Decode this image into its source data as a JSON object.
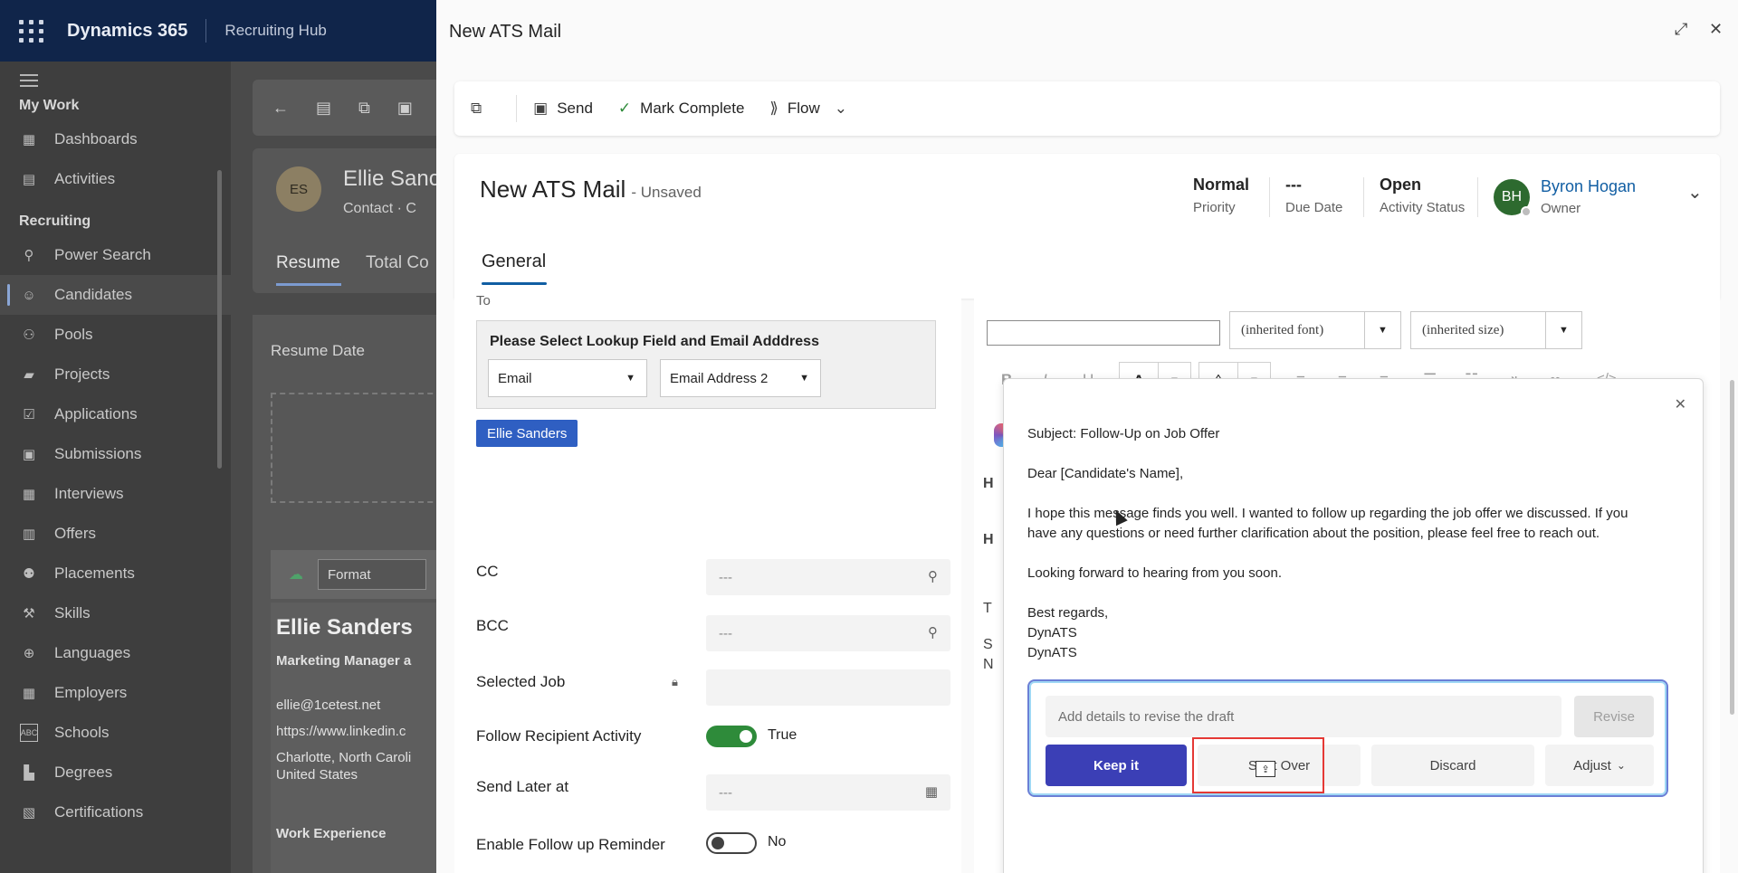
{
  "topbar": {
    "brand": "Dynamics 365",
    "hub": "Recruiting Hub"
  },
  "sidebar": {
    "sections": [
      {
        "title": "My Work",
        "items": [
          {
            "label": "Dashboards",
            "icon": "dashboard-icon"
          },
          {
            "label": "Activities",
            "icon": "clipboard-icon"
          }
        ]
      },
      {
        "title": "Recruiting",
        "items": [
          {
            "label": "Power Search",
            "icon": "search-icon"
          },
          {
            "label": "Candidates",
            "icon": "person-icon",
            "active": true
          },
          {
            "label": "Pools",
            "icon": "people-icon"
          },
          {
            "label": "Projects",
            "icon": "briefcase-icon"
          },
          {
            "label": "Applications",
            "icon": "checkbox-icon"
          },
          {
            "label": "Submissions",
            "icon": "id-card-icon"
          },
          {
            "label": "Interviews",
            "icon": "calendar-icon"
          },
          {
            "label": "Offers",
            "icon": "document-icon"
          },
          {
            "label": "Placements",
            "icon": "placement-icon"
          },
          {
            "label": "Skills",
            "icon": "tools-icon"
          },
          {
            "label": "Languages",
            "icon": "globe-icon"
          },
          {
            "label": "Employers",
            "icon": "building-icon"
          },
          {
            "label": "Schools",
            "icon": "abc-icon"
          },
          {
            "label": "Degrees",
            "icon": "book-icon"
          },
          {
            "label": "Certifications",
            "icon": "certificate-icon"
          }
        ]
      }
    ]
  },
  "background_record": {
    "initials": "ES",
    "name": "Ellie Sanc",
    "subtitle": "Contact · C",
    "tabs": [
      "Resume",
      "Total Co"
    ],
    "resume_date_label": "Resume Date",
    "format_label": "Format",
    "doc": {
      "name": "Ellie Sanders",
      "role": "Marketing Manager a",
      "email": "ellie@1cetest.net",
      "link": "https://www.linkedin.c",
      "address1": "Charlotte, North Caroli",
      "address2": "United States",
      "section": "Work Experience"
    }
  },
  "panel": {
    "title": "New ATS Mail",
    "commands": {
      "send": "Send",
      "mark_complete": "Mark Complete",
      "flow": "Flow"
    },
    "header": {
      "title": "New ATS Mail",
      "unsaved": "- Unsaved",
      "priority_value": "Normal",
      "priority_label": "Priority",
      "due_value": "---",
      "due_label": "Due Date",
      "status_value": "Open",
      "status_label": "Activity Status",
      "owner_initials": "BH",
      "owner_name": "Byron Hogan",
      "owner_label": "Owner"
    },
    "tab": "General",
    "form": {
      "to_label": "To",
      "lookup_title": "Please Select Lookup Field and Email Adddress",
      "lookup_field": "Email",
      "email_address": "Email Address 2",
      "recipient_chip": "Ellie Sanders",
      "cc_label": "CC",
      "cc_value": "---",
      "bcc_label": "BCC",
      "bcc_value": "---",
      "selected_job_label": "Selected Job",
      "follow_label": "Follow Recipient Activity",
      "follow_value": "True",
      "send_later_label": "Send Later at",
      "send_later_value": "---",
      "reminder_label": "Enable Follow up Reminder",
      "reminder_value": "No"
    },
    "editor": {
      "font": "(inherited font)",
      "size": "(inherited size)",
      "bold": "B",
      "italic": "I",
      "underline": "U",
      "font_color": "A",
      "behind_letters": [
        "H",
        "H",
        "T",
        "S",
        "N"
      ]
    },
    "draft": {
      "subject": "Subject: Follow-Up on Job Offer",
      "greeting": "Dear [Candidate's Name],",
      "body": "I hope this message finds you well. I wanted to follow up regarding the job offer we discussed. If you have any questions or need further clarification about the position, please feel free to reach out.",
      "closing": "Looking forward to hearing from you soon.",
      "signoff": "Best regards,",
      "sig1": "DynATS",
      "sig2": "DynATS",
      "revise_placeholder": "Add details to revise the draft",
      "revise_label": "Revise",
      "keep_label": "Keep it",
      "start_over_label": "Start Over",
      "discard_label": "Discard",
      "adjust_label": "Adjust"
    }
  }
}
